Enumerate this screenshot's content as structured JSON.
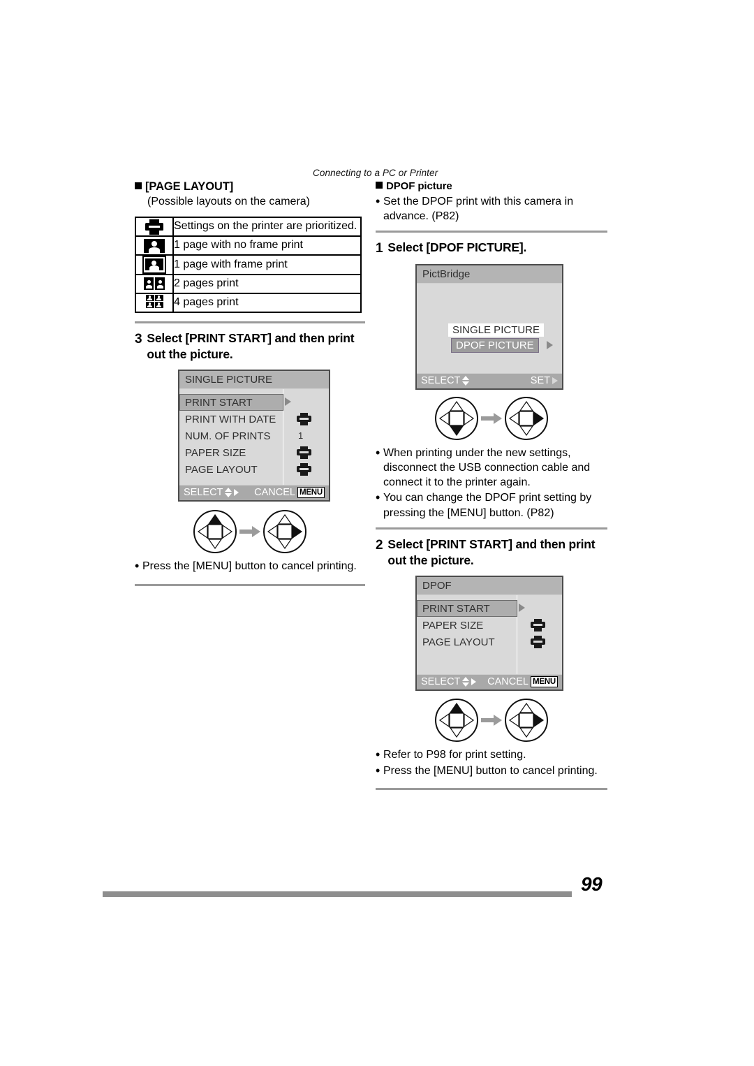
{
  "running_head": "Connecting to a PC or Printer",
  "folio": "99",
  "left_column": {
    "page_layout_heading": "[PAGE LAYOUT]",
    "page_layout_subtitle": "(Possible layouts on the camera)",
    "table": {
      "rows": [
        {
          "icon": "printer-icon",
          "description": "Settings on the printer are prioritized."
        },
        {
          "icon": "one-page-no-frame-icon",
          "description": "1 page with no frame print"
        },
        {
          "icon": "one-page-with-frame-icon",
          "description": "1 page with frame print"
        },
        {
          "icon": "two-pages-icon",
          "description": "2 pages print"
        },
        {
          "icon": "four-pages-icon",
          "description": "4 pages print"
        }
      ]
    },
    "step": {
      "number": "3",
      "text": "Select [PRINT START] and then print out the picture."
    },
    "screen": {
      "title": "SINGLE PICTURE",
      "rows": [
        {
          "label": "PRINT START",
          "value": "arrow",
          "selected": true
        },
        {
          "label": "PRINT WITH DATE",
          "value": "printer-icon",
          "selected": false
        },
        {
          "label": "NUM. OF PRINTS",
          "value": "1",
          "selected": false
        },
        {
          "label": "PAPER SIZE",
          "value": "printer-icon",
          "selected": false
        },
        {
          "label": "PAGE LAYOUT",
          "value": "printer-icon",
          "selected": false
        }
      ],
      "status_left": "SELECT",
      "status_right": "CANCEL",
      "status_chip": "MENU"
    },
    "navpads": [
      {
        "filled": "up"
      },
      {
        "filled": "right"
      }
    ],
    "bullets": [
      "Press the [MENU] button to cancel printing."
    ]
  },
  "right_column": {
    "dpof_heading": "DPOF picture",
    "dpof_bullets": [
      "Set the DPOF print with this camera in advance. (P82)"
    ],
    "step1": {
      "number": "1",
      "text": "Select [DPOF PICTURE]."
    },
    "pictbridge_screen": {
      "title": "PictBridge",
      "options": [
        {
          "label": "SINGLE PICTURE",
          "selected": false
        },
        {
          "label": "DPOF PICTURE",
          "selected": true
        }
      ],
      "status_left": "SELECT",
      "status_right": "SET"
    },
    "navpads1": [
      {
        "filled": "down"
      },
      {
        "filled": "right"
      }
    ],
    "mid_bullets": [
      "When printing under the new settings, disconnect the USB connection cable and connect it to the printer again.",
      "You can change the DPOF print setting by pressing the [MENU] button. (P82)"
    ],
    "step2": {
      "number": "2",
      "text": "Select [PRINT START] and then print out the picture."
    },
    "dpof_screen": {
      "title": "DPOF",
      "rows": [
        {
          "label": "PRINT START",
          "value": "arrow",
          "selected": true
        },
        {
          "label": "PAPER SIZE",
          "value": "printer-icon",
          "selected": false
        },
        {
          "label": "PAGE LAYOUT",
          "value": "printer-icon",
          "selected": false
        }
      ],
      "status_left": "SELECT",
      "status_right": "CANCEL",
      "status_chip": "MENU"
    },
    "navpads2": [
      {
        "filled": "up"
      },
      {
        "filled": "right"
      }
    ],
    "bottom_bullets": [
      "Refer to P98 for print setting.",
      "Press the [MENU] button to cancel printing."
    ]
  },
  "colors": {
    "rule": "#9a9a9a",
    "screen_border": "#4c4c4c",
    "screen_bg": "#d9d9d9",
    "title_bar": "#b4b4b4",
    "status_bar": "#a9a9a9",
    "selected_row": "#adadad",
    "footer_rule": "#8e8e8e"
  }
}
